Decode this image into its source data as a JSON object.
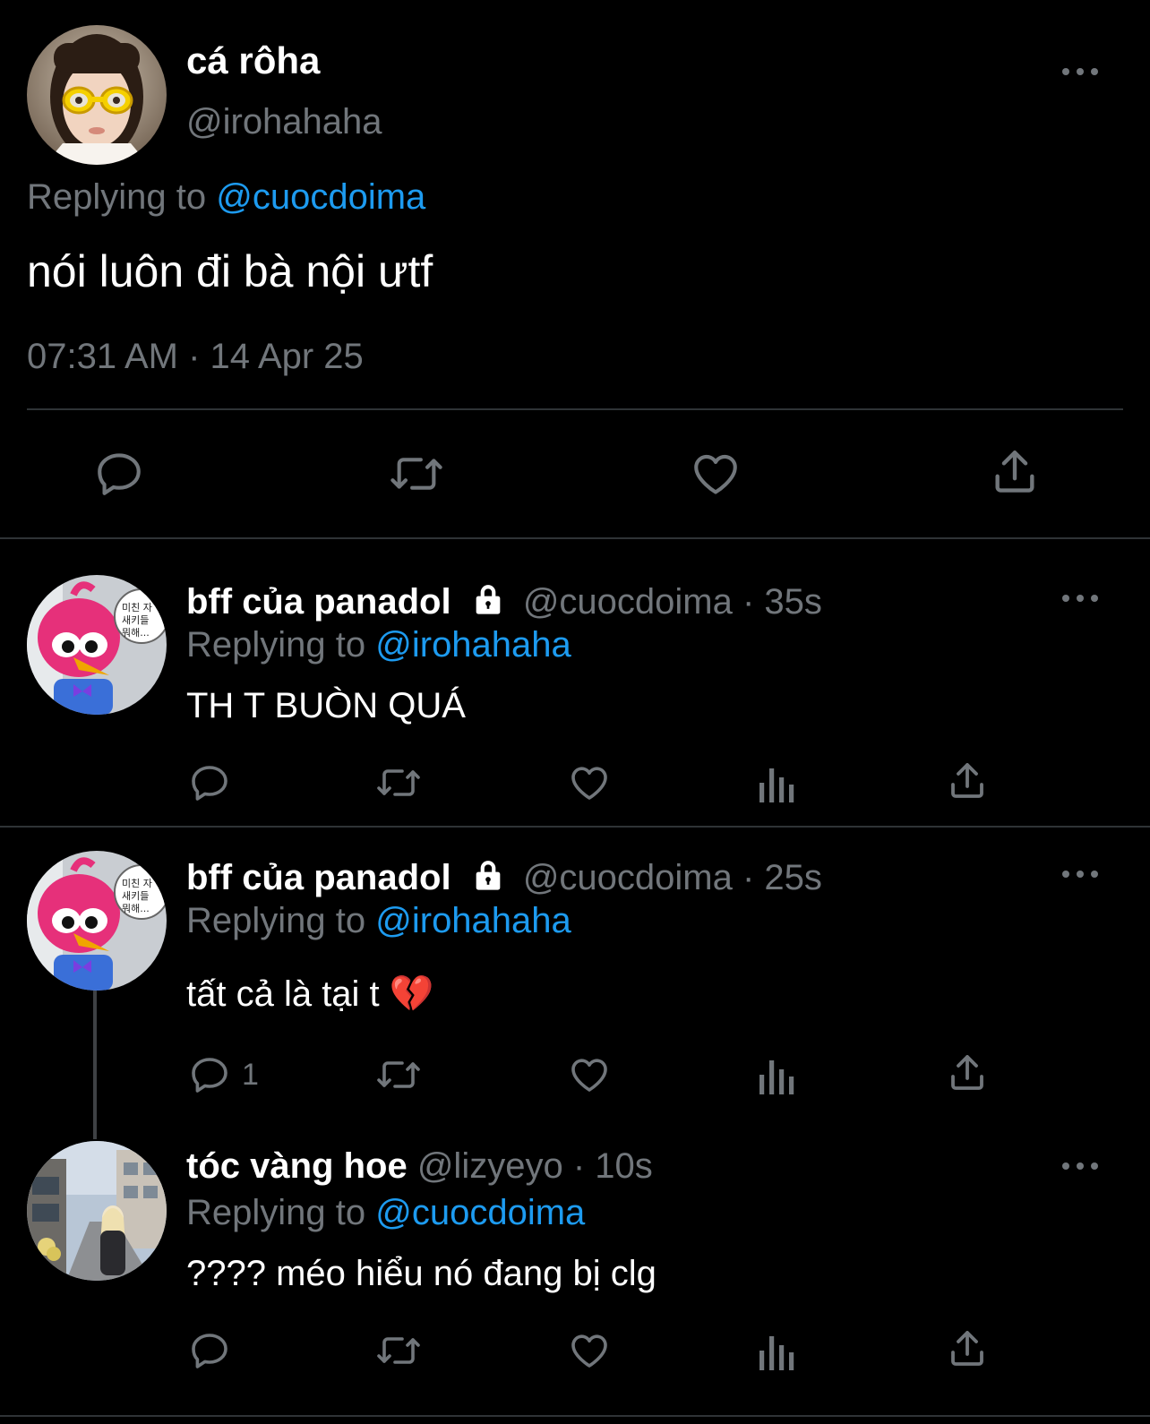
{
  "main_tweet": {
    "display_name": "cá rôha",
    "handle": "@irohahaha",
    "replying_prefix": "Replying to",
    "replying_to": "@cuocdoima",
    "text": "nói luôn đi bà nội ưtf",
    "timestamp": "07:31 AM · 14 Apr 25",
    "avatar_icon": "avatar-girl-goggles"
  },
  "replies": [
    {
      "display_name": "bff của panadol",
      "handle": "@cuocdoima",
      "time": "· 35s",
      "replying_prefix": "Replying to",
      "replying_to": "@irohahaha",
      "text": "TH T BUÒN QUÁ",
      "reply_count": "",
      "avatar_icon": "avatar-pink-bird",
      "speech_bubble_text": "미친 자 새키들 뭐해..."
    },
    {
      "display_name": "bff của panadol",
      "handle": "@cuocdoima",
      "time": "· 25s",
      "replying_prefix": "Replying to",
      "replying_to": "@irohahaha",
      "text": "tất cả là tại t 💔",
      "reply_count": "1",
      "avatar_icon": "avatar-pink-bird",
      "speech_bubble_text": "미친 자 새키들 뭐해..."
    },
    {
      "display_name": "tóc vàng hoe",
      "handle": "@lizyeyo",
      "time": "· 10s",
      "replying_prefix": "Replying to",
      "replying_to": "@cuocdoima",
      "text": "???? méo hiểu nó đang bị clg",
      "reply_count": "",
      "avatar_icon": "avatar-street-photo"
    }
  ],
  "colors": {
    "background": "#000000",
    "text": "#e7e9ea",
    "muted": "#71767b",
    "link": "#1d9bf0",
    "divider": "#2f3336"
  }
}
